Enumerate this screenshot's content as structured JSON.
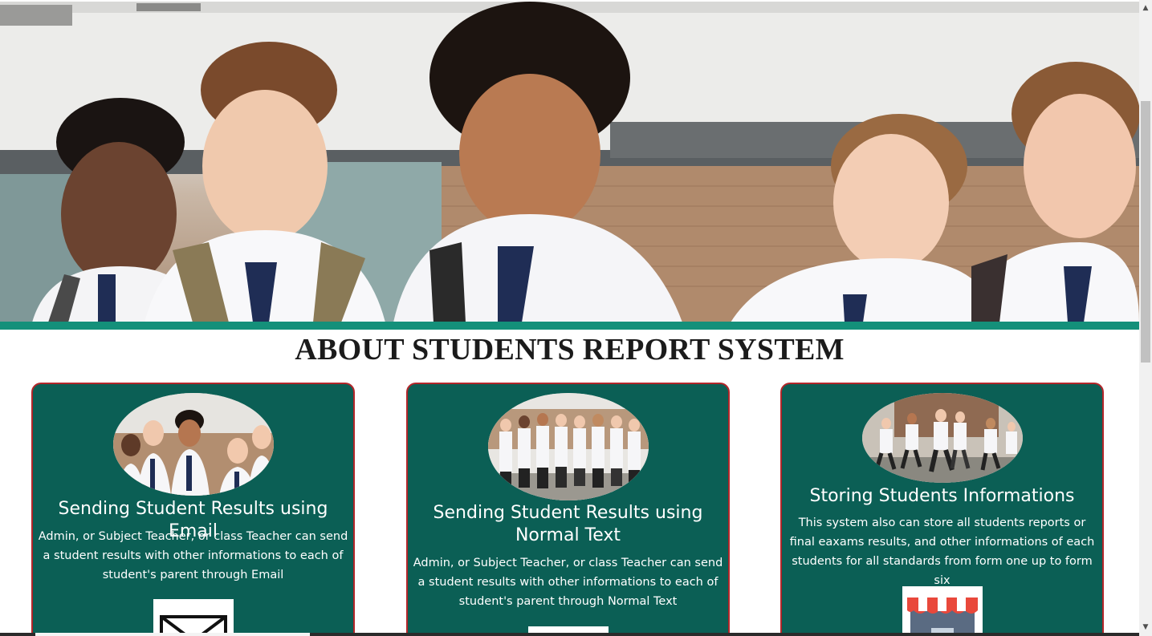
{
  "hero": {
    "image": "students-group-photo"
  },
  "section": {
    "title": "ABOUT STUDENTS REPORT SYSTEM"
  },
  "cards": [
    {
      "title": "Sending Student Results using Email",
      "text": "Admin, or Subject Teacher, or class Teacher can send a student results with other informations to each of student's parent through Email",
      "image": "students-smiling-photo",
      "icon": "envelope-icon"
    },
    {
      "title": "Sending Student Results using Normal Text",
      "text": "Admin, or Subject Teacher, or class Teacher can send a student results with other informations to each of student's parent through Normal Text",
      "image": "students-standing-photo",
      "icon": "message-icon"
    },
    {
      "title": "Storing Students Informations",
      "text": "This system also can store all students reports or final eaxams results, and other informations of each students for all standards from form one up to form six",
      "image": "students-running-photo",
      "icon": "store-icon"
    }
  ],
  "colors": {
    "accent_band": "#14907a",
    "card_bg": "#0b5f55",
    "card_border": "#b3262a"
  }
}
